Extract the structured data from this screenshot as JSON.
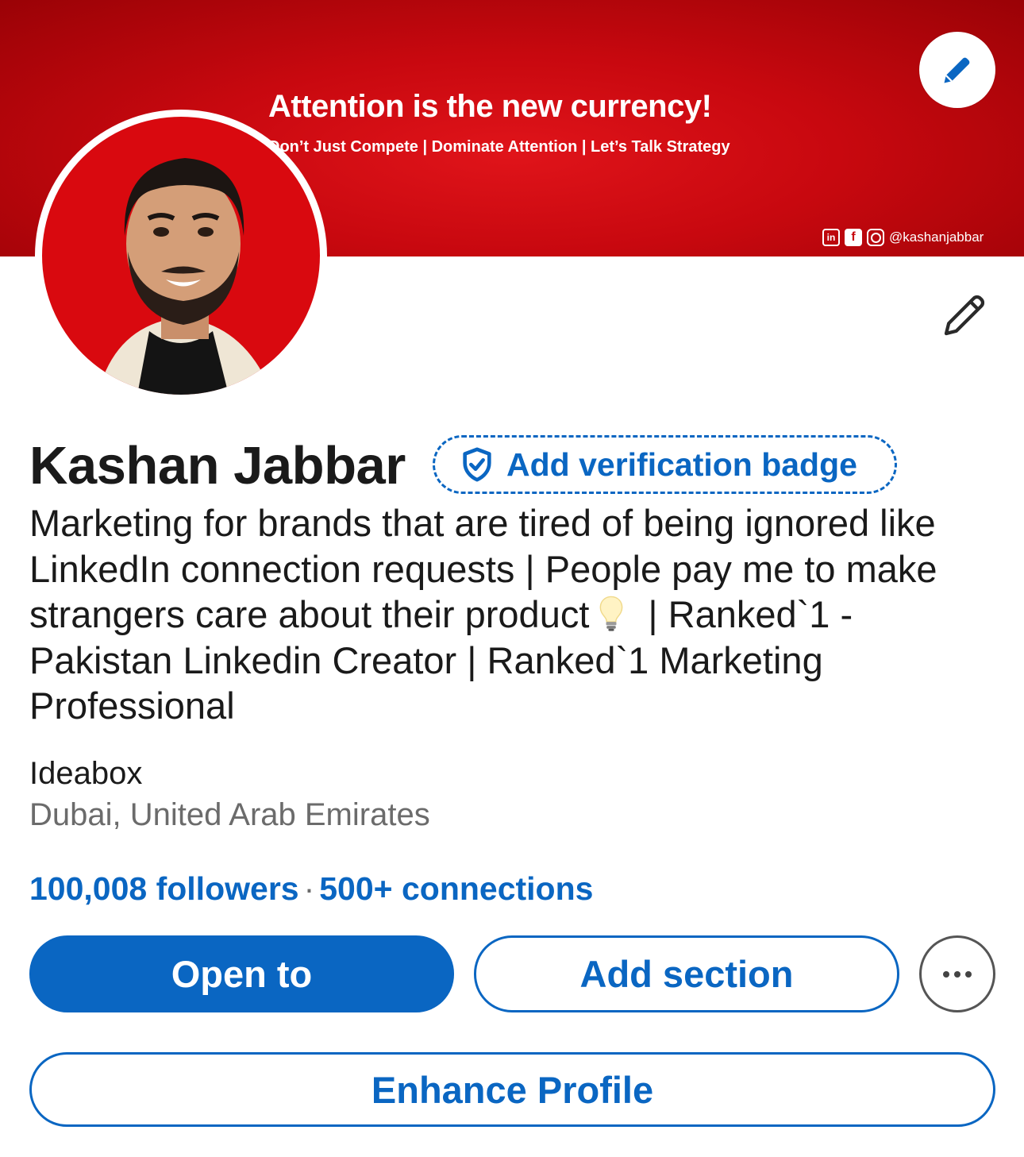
{
  "banner": {
    "title": "Attention is the new currency!",
    "subtitle": "Don’t Just Compete | Dominate Attention | Let’s Talk Strategy",
    "social_handle": "@kashanjabbar",
    "social_icons": [
      "linkedin-icon",
      "facebook-icon",
      "instagram-icon"
    ],
    "color": "#c8080f"
  },
  "profile": {
    "name": "Kashan Jabbar",
    "verification_label": "Add verification badge",
    "headline_part1": "Marketing for brands that are tired of being ignored like LinkedIn connection requests | People pay me to make strangers care about their product",
    "headline_part2": "| Ranked`1 - Pakistan Linkedin Creator | Ranked`1 Marketing Professional",
    "company": "Ideabox",
    "location": "Dubai, United Arab Emirates",
    "followers": "100,008 followers",
    "separator": "·",
    "connections": "500+ connections"
  },
  "actions": {
    "open_to": "Open to",
    "add_section": "Add section",
    "more_icon": "more-horizontal-icon",
    "enhance_profile": "Enhance Profile"
  },
  "colors": {
    "accent": "#0a66c2",
    "text": "#1a1a1a",
    "muted": "#6b6b6b"
  }
}
